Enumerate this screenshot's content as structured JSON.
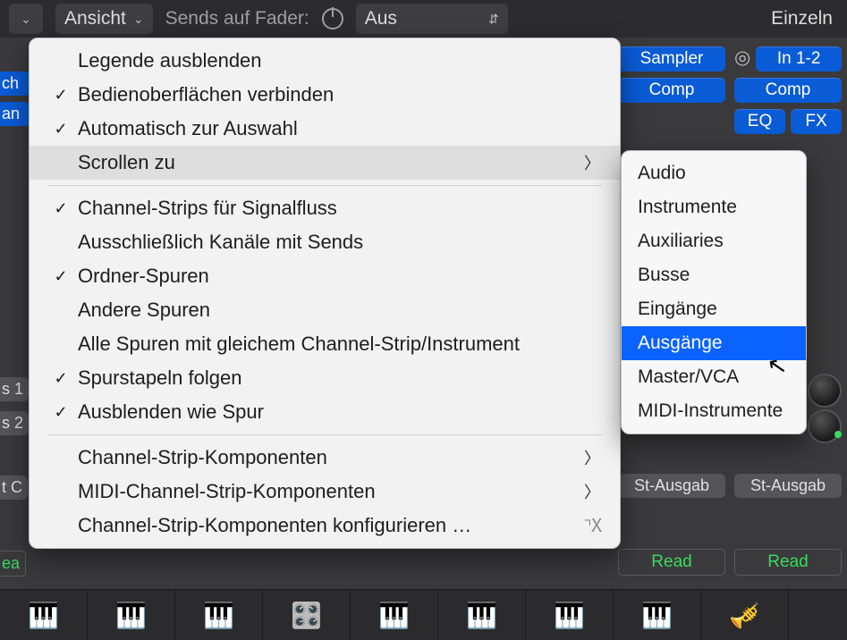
{
  "toolbar": {
    "view_label": "Ansicht",
    "sends_label": "Sends auf Fader:",
    "sends_value": "Aus",
    "right_label": "Einzeln"
  },
  "left_edge": {
    "chip1": "ch",
    "chip2": "an",
    "bus1": "s 1",
    "bus2": "s 2",
    "out": "t C",
    "read": "ea"
  },
  "right_panel": {
    "sampler": "Sampler",
    "io": "In 1-2",
    "comp": "Comp",
    "eq": "EQ",
    "fx": "FX",
    "out": "St-Ausgab",
    "read": "Read"
  },
  "menu": {
    "items": [
      {
        "label": "Legende ausblenden",
        "checked": false
      },
      {
        "label": "Bedienoberflächen verbinden",
        "checked": true
      },
      {
        "label": "Automatisch zur Auswahl",
        "checked": true
      },
      {
        "label": "Scrollen zu",
        "checked": false,
        "submenu": true,
        "highlight": true
      }
    ],
    "items2": [
      {
        "label": "Channel-Strips für Signalfluss",
        "checked": true
      },
      {
        "label": "Ausschließlich Kanäle mit Sends",
        "checked": false
      },
      {
        "label": "Ordner-Spuren",
        "checked": true
      },
      {
        "label": "Andere Spuren",
        "checked": false
      },
      {
        "label": "Alle Spuren mit gleichem Channel-Strip/Instrument",
        "checked": false
      },
      {
        "label": "Spurstapeln folgen",
        "checked": true
      },
      {
        "label": "Ausblenden wie Spur",
        "checked": true
      }
    ],
    "items3": [
      {
        "label": "Channel-Strip-Komponenten",
        "submenu": true
      },
      {
        "label": "MIDI-Channel-Strip-Komponenten",
        "submenu": true
      },
      {
        "label": "Channel-Strip-Komponenten konfigurieren …",
        "shortcut": true
      }
    ]
  },
  "submenu": {
    "items": [
      "Audio",
      "Instrumente",
      "Auxiliaries",
      "Busse",
      "Eingänge",
      "Ausgänge",
      "Master/VCA",
      "MIDI-Instrumente"
    ],
    "selected_index": 5
  },
  "instruments": [
    "🎹",
    "🎹",
    "🎹",
    "🎛️",
    "🎹",
    "🎹",
    "🎹",
    "🎹",
    "🎺"
  ]
}
